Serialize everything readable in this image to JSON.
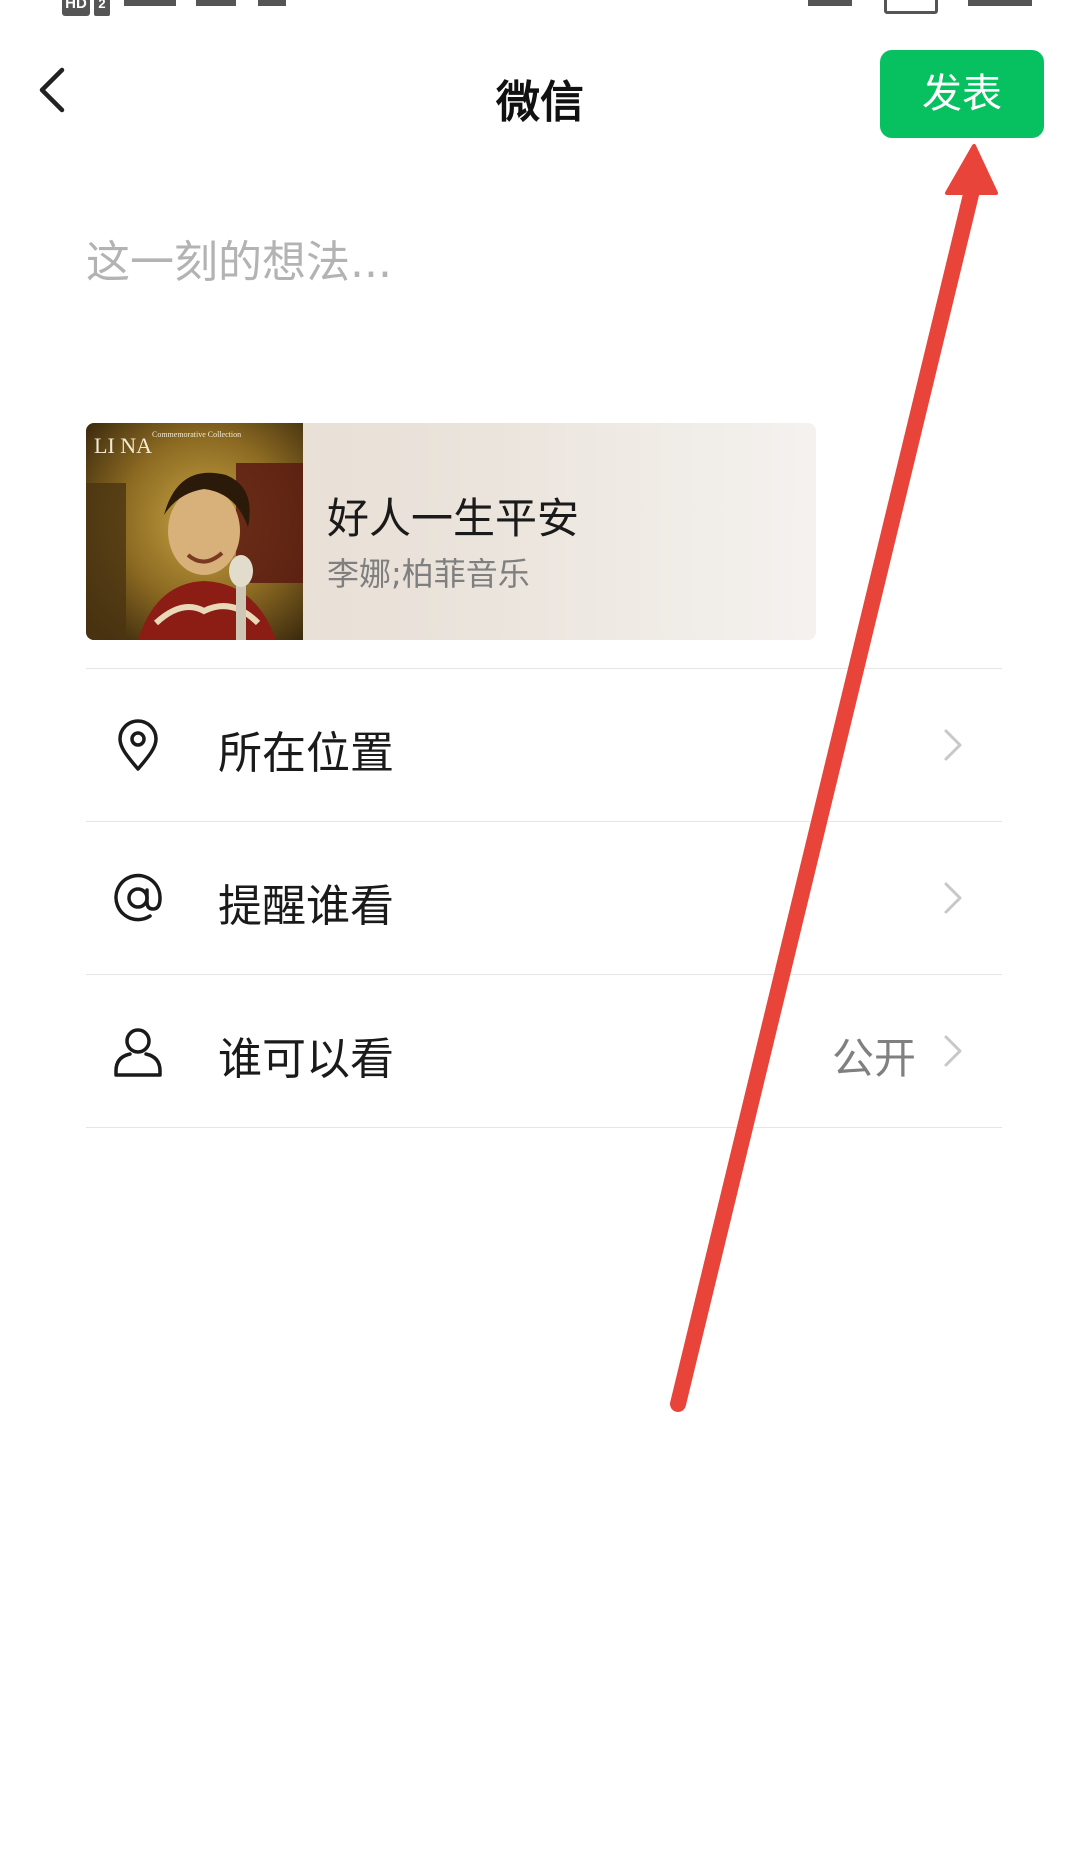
{
  "status_bar": {
    "network_badge": "HD",
    "sim_badge": "2"
  },
  "header": {
    "back_icon": "chevron-left-icon",
    "title": "微信",
    "publish_label": "发表",
    "publish_color": "#07c160"
  },
  "composer": {
    "placeholder": "这一刻的想法..."
  },
  "music_card": {
    "album_art_text": "LI NA",
    "album_art_subtext": "Commemorative Collection",
    "title": "好人一生平安",
    "artist": "李娜;柏菲音乐"
  },
  "options": [
    {
      "icon": "location-pin-icon",
      "label": "所在位置",
      "value": ""
    },
    {
      "icon": "at-sign-icon",
      "label": "提醒谁看",
      "value": ""
    },
    {
      "icon": "person-icon",
      "label": "谁可以看",
      "value": "公开"
    }
  ],
  "annotation": {
    "type": "arrow",
    "color": "#e8443a",
    "points_to": "publish-button"
  }
}
